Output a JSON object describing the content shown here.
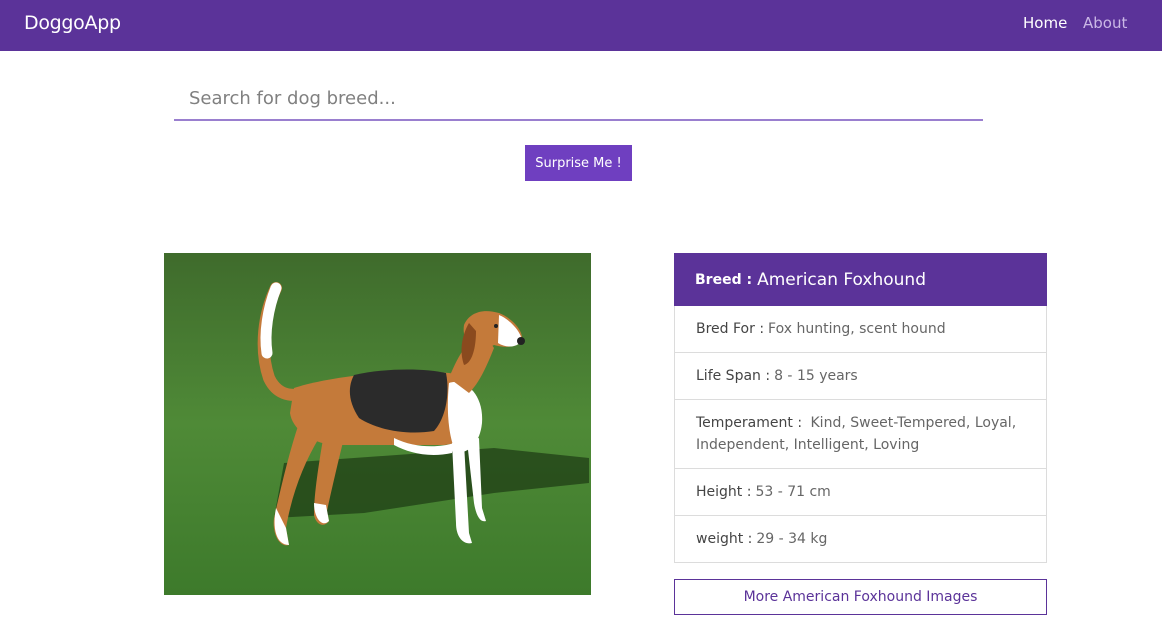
{
  "navbar": {
    "brand": "DoggoApp",
    "links": [
      {
        "label": "Home"
      },
      {
        "label": "About"
      }
    ],
    "color": "#5b3399"
  },
  "search": {
    "placeholder": "Search for dog breed...",
    "value": ""
  },
  "surprise_button": {
    "label": "Surprise Me !"
  },
  "dog_image": {
    "subject": "American Foxhound standing on grass"
  },
  "breed_card": {
    "header": {
      "label": "Breed :",
      "value": "American Foxhound"
    },
    "bred_for": {
      "label": "Bred For :",
      "value": "Fox hunting, scent hound"
    },
    "life_span": {
      "label": "Life Span :",
      "value": "8 - 15 years"
    },
    "temperament": {
      "label": "Temperament :",
      "value": "Kind, Sweet-Tempered, Loyal, Independent, Intelligent, Loving"
    },
    "height": {
      "label": "Height :",
      "value": "53 - 71 cm"
    },
    "weight": {
      "label": "weight :",
      "value": "29 - 34 kg"
    }
  },
  "more_images_button": {
    "label": "More American Foxhound Images"
  }
}
